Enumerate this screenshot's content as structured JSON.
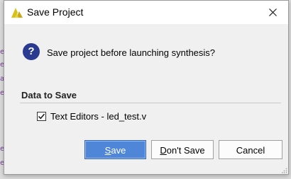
{
  "window": {
    "title": "Save Project",
    "close_icon": "close-icon",
    "app_icon": "vivado-logo-icon"
  },
  "dialog": {
    "icon": "question-icon",
    "icon_glyph": "?",
    "message": "Save project before launching synthesis?",
    "section_title": "Data to Save",
    "items": [
      {
        "label": "Text Editors - led_test.v",
        "checked": true
      }
    ]
  },
  "buttons": {
    "save": {
      "label": "Save",
      "mnemonic": "S",
      "rest": "ave",
      "default": true
    },
    "dont_save": {
      "label": "Don't Save",
      "mnemonic": "D",
      "rest": "on't Save"
    },
    "cancel": {
      "label": "Cancel"
    }
  },
  "background": {
    "glyphs": [
      "e",
      "e",
      "ay",
      "e",
      "e",
      "e"
    ]
  },
  "colors": {
    "accent": "#4f86d8",
    "question_icon_bg": "#2b3a91",
    "logo": "#d8c21a"
  }
}
